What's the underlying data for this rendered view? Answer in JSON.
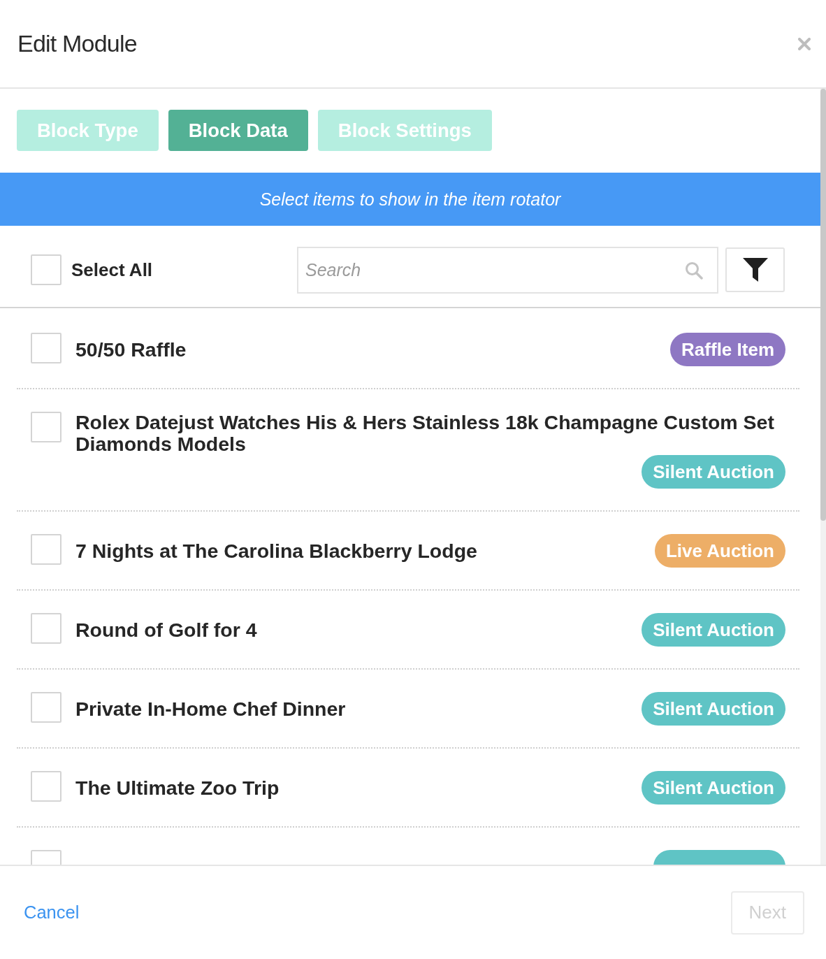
{
  "window": {
    "title": "Edit Module"
  },
  "tabs": [
    {
      "label": "Block Type",
      "selected": false
    },
    {
      "label": "Block Data",
      "selected": true
    },
    {
      "label": "Block Settings",
      "selected": false
    }
  ],
  "banner": {
    "text": "Select items to show in the item rotator"
  },
  "toolbar": {
    "select_all": {
      "label": "Select All",
      "checked": false
    },
    "search": {
      "placeholder": "Search"
    }
  },
  "items": [
    {
      "title": "50/50 Raffle",
      "checked": false,
      "tag": {
        "label": "Raffle Item",
        "color": "#8e77c3"
      }
    },
    {
      "title": "Rolex Datejust Watches His & Hers Stainless 18k Champagne Custom Set Diamonds Models",
      "checked": false,
      "tag": {
        "label": "Silent Auction",
        "color": "#5fc4c5"
      }
    },
    {
      "title": "7 Nights at The Carolina Blackberry Lodge",
      "checked": false,
      "tag": {
        "label": "Live Auction",
        "color": "#edae67"
      }
    },
    {
      "title": "Round of Golf for 4",
      "checked": false,
      "tag": {
        "label": "Silent Auction",
        "color": "#5fc4c5"
      }
    },
    {
      "title": "Private In-Home Chef Dinner",
      "checked": false,
      "tag": {
        "label": "Silent Auction",
        "color": "#5fc4c5"
      }
    },
    {
      "title": "The Ultimate Zoo Trip",
      "checked": false,
      "tag": {
        "label": "Silent Auction",
        "color": "#5fc4c5"
      }
    },
    {
      "checked": false,
      "tag": {
        "color": "#5fc4c5"
      }
    }
  ],
  "footer": {
    "cancel": "Cancel",
    "next": {
      "label": "Next",
      "disabled": true
    }
  }
}
